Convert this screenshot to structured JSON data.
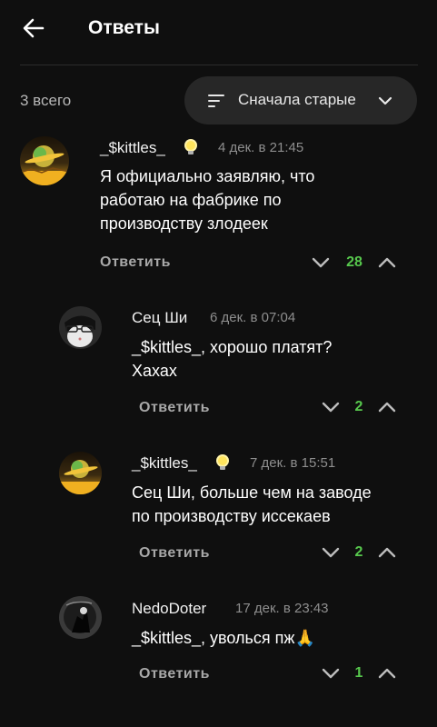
{
  "header": {
    "title": "Ответы"
  },
  "count_label": "3 всего",
  "sort": {
    "label": "Сначала старые"
  },
  "main_comment": {
    "author": "_$kittles_",
    "time": "4 дек. в 21:45",
    "text": "Я официально заявляю, что\nработаю на фабрике по\nпроизводству злодеек",
    "reply_label": "Ответить",
    "score": "28"
  },
  "replies": [
    {
      "author": "Сец Ши",
      "time": "6 дек. в 07:04",
      "text": "_$kittles_, хорошо платят?\nХахах",
      "reply_label": "Ответить",
      "score": "2"
    },
    {
      "author": "_$kittles_",
      "time": "7 дек. в 15:51",
      "text": "Сец Ши, больше чем на заводе\nпо производству иссекаев",
      "reply_label": "Ответить",
      "score": "2"
    },
    {
      "author": "NedoDoter",
      "time": "17 дек. в 23:43",
      "text": "_$kittles_, уволься пж🙏",
      "reply_label": "Ответить",
      "score": "1"
    }
  ],
  "icons": {
    "back": "arrow-left-icon",
    "sort": "sort-lines-icon",
    "chevron": "chevron-down-icon",
    "badge": "lightbulb-icon",
    "vote_down": "chevron-down-icon",
    "vote_up": "chevron-up-icon"
  },
  "colors": {
    "background": "#0f0f0f",
    "score": "#57c84d",
    "muted": "#8e8e8e"
  }
}
